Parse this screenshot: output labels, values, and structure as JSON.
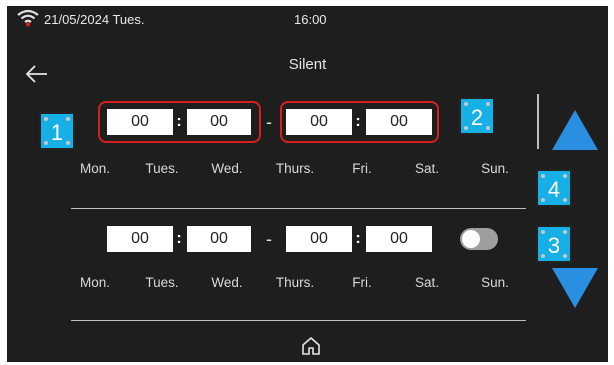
{
  "status_bar": {
    "date": "21/05/2024 Tues.",
    "time": "16:00",
    "wifi_icon": "wifi-icon"
  },
  "header": {
    "back_icon": "back-arrow-icon",
    "title": "Silent"
  },
  "schedules": [
    {
      "start_hour": "00",
      "start_minute": "00",
      "end_hour": "00",
      "end_minute": "00",
      "separator": ":",
      "range_separator": "-",
      "days": [
        "Mon.",
        "Tues.",
        "Wed.",
        "Thurs.",
        "Fri.",
        "Sat.",
        "Sun."
      ]
    },
    {
      "start_hour": "00",
      "start_minute": "00",
      "end_hour": "00",
      "end_minute": "00",
      "separator": ":",
      "range_separator": "-",
      "enabled": false,
      "days": [
        "Mon.",
        "Tues.",
        "Wed.",
        "Thurs.",
        "Fri.",
        "Sat.",
        "Sun."
      ]
    }
  ],
  "markers": {
    "m1": "1",
    "m2": "2",
    "m3": "3",
    "m4": "4"
  },
  "nav": {
    "scroll_up_icon": "triangle-up-icon",
    "scroll_down_icon": "triangle-down-icon",
    "home_icon": "home-icon"
  },
  "colors": {
    "background": "#1e1e1e",
    "accent": "#2a8fe0",
    "highlight_frame": "#d62020",
    "marker": "#16b0e6"
  }
}
